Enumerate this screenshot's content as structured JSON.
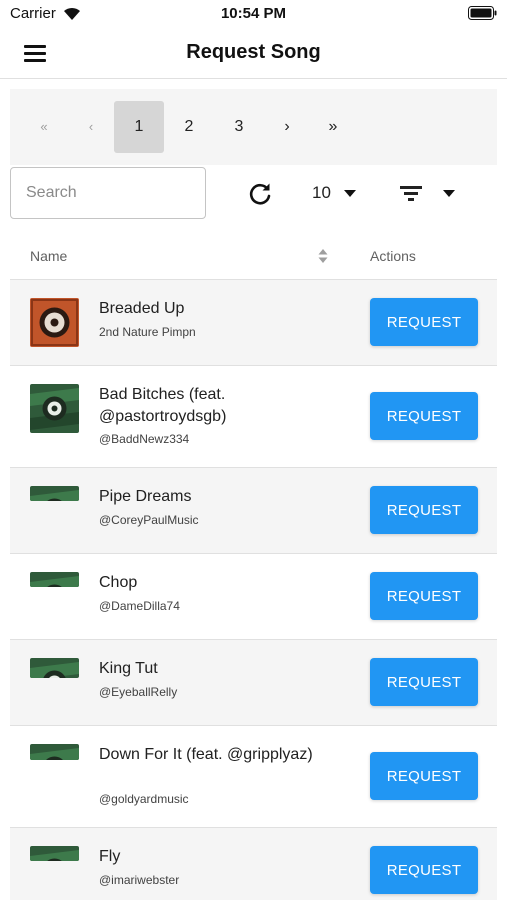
{
  "status_bar": {
    "carrier": "Carrier",
    "time": "10:54 PM"
  },
  "app_bar": {
    "title": "Request Song",
    "menu_icon": "hamburger-menu-icon"
  },
  "pagination": {
    "first": "«",
    "prev": "‹",
    "pages": [
      "1",
      "2",
      "3"
    ],
    "active_page": "1",
    "next": "›",
    "last": "»"
  },
  "toolbar": {
    "search_placeholder": "Search",
    "refresh_icon": "refresh-icon",
    "per_page": "10",
    "filter_icon": "filter-icon"
  },
  "table": {
    "columns": {
      "name": "Name",
      "actions": "Actions"
    },
    "request_label": "REQUEST",
    "rows": [
      {
        "title": "Breaded Up",
        "artist": "2nd Nature Pimpn"
      },
      {
        "title": "Bad Bitches (feat. @pastortroydsgb)",
        "artist": "@BaddNewz334"
      },
      {
        "title": "Pipe Dreams",
        "artist": "@CoreyPaulMusic"
      },
      {
        "title": "Chop",
        "artist": "@DameDilla74"
      },
      {
        "title": "King Tut",
        "artist": "@EyeballRelly"
      },
      {
        "title": "Down For It (feat. @gripplyaz)",
        "artist": "@goldyardmusic"
      },
      {
        "title": "Fly",
        "artist": "@imariwebster"
      }
    ]
  },
  "colors": {
    "accent": "#2196f3",
    "stripe": "#f5f5f5",
    "divider": "#e0e0e0"
  }
}
